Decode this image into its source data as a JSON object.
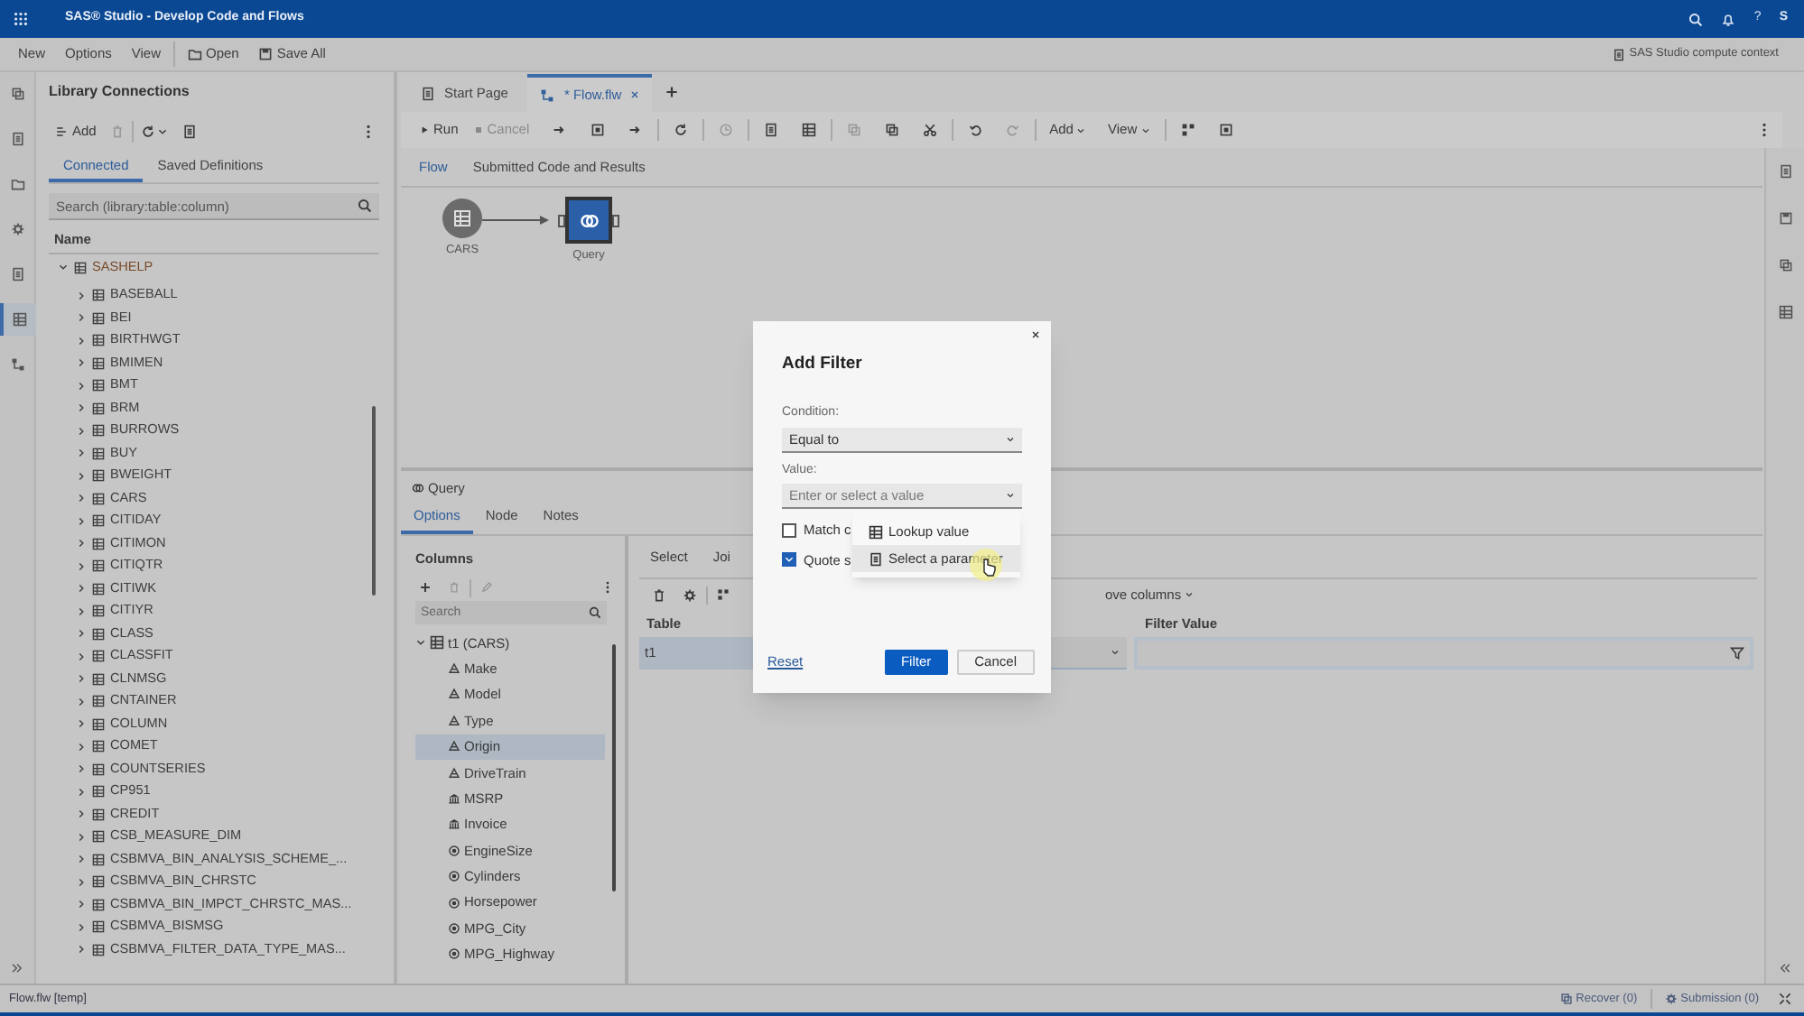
{
  "title_bar": {
    "title": "SAS® Studio - Develop Code and Flows",
    "help": "?",
    "user_initial": "S"
  },
  "menu_bar": {
    "items": [
      {
        "label": "New",
        "kind": "menu"
      },
      {
        "label": "Options",
        "kind": "menu"
      },
      {
        "label": "View",
        "kind": "menu"
      },
      {
        "label": "Open",
        "kind": "open"
      },
      {
        "label": "Save All",
        "kind": "save"
      }
    ],
    "context": "SAS Studio compute context"
  },
  "library_panel": {
    "title": "Library Connections",
    "add": "Add",
    "tabs": [
      {
        "label": "Connected",
        "selected": true
      },
      {
        "label": "Saved Definitions",
        "selected": false
      }
    ],
    "search": {
      "placeholder": "Search (library:table:column)"
    },
    "column_header": "Name",
    "tree": [
      {
        "label": "SASHELP",
        "expanded": true,
        "children": [
          {
            "label": "BASEBALL",
            "expanded": false
          },
          {
            "label": "BEI",
            "expanded": false
          },
          {
            "label": "BIRTHWGT",
            "expanded": false
          },
          {
            "label": "BMIMEN",
            "expanded": false
          },
          {
            "label": "BMT",
            "expanded": false
          },
          {
            "label": "BRM",
            "expanded": false
          },
          {
            "label": "BURROWS",
            "expanded": false
          },
          {
            "label": "BUY",
            "expanded": false
          },
          {
            "label": "BWEIGHT",
            "expanded": false
          },
          {
            "label": "CARS",
            "expanded": false
          },
          {
            "label": "CITIDAY",
            "expanded": false
          },
          {
            "label": "CITIMON",
            "expanded": false
          },
          {
            "label": "CITIQTR",
            "expanded": false
          },
          {
            "label": "CITIWK",
            "expanded": false
          },
          {
            "label": "CITIYR",
            "expanded": false
          },
          {
            "label": "CLASS",
            "expanded": false
          },
          {
            "label": "CLASSFIT",
            "expanded": false
          },
          {
            "label": "CLNMSG",
            "expanded": false
          },
          {
            "label": "CNTAINER",
            "expanded": false
          },
          {
            "label": "COLUMN",
            "expanded": false
          },
          {
            "label": "COMET",
            "expanded": false
          },
          {
            "label": "COUNTSERIES",
            "expanded": false
          },
          {
            "label": "CP951",
            "expanded": false
          },
          {
            "label": "CREDIT",
            "expanded": false
          },
          {
            "label": "CSB_MEASURE_DIM",
            "expanded": false
          },
          {
            "label": "CSBMVA_BIN_ANALYSIS_SCHEME_...",
            "expanded": false
          },
          {
            "label": "CSBMVA_BIN_CHRSTC",
            "expanded": false
          },
          {
            "label": "CSBMVA_BIN_IMPCT_CHRSTC_MAS...",
            "expanded": false
          },
          {
            "label": "CSBMVA_BISMSG",
            "expanded": false
          },
          {
            "label": "CSBMVA_FILTER_DATA_TYPE_MAS...",
            "expanded": false
          }
        ]
      }
    ]
  },
  "editor_tabs": [
    {
      "label": "Start Page",
      "kind": "page",
      "selected": false
    },
    {
      "label": "* Flow.flw",
      "kind": "flow",
      "selected": true
    }
  ],
  "toolbar": {
    "run": "Run",
    "cancel": "Cancel",
    "add": "Add",
    "view": "View"
  },
  "view_tabs": [
    {
      "label": "Flow",
      "selected": true
    },
    {
      "label": "Submitted Code and Results",
      "selected": false
    }
  ],
  "flow": {
    "nodes": [
      {
        "label": "CARS",
        "kind": "table",
        "selected": false
      },
      {
        "label": "Query",
        "kind": "query",
        "selected": true
      }
    ]
  },
  "query_panel": {
    "title": "Query",
    "tabs": [
      {
        "label": "Options",
        "selected": true
      },
      {
        "label": "Node",
        "selected": false
      },
      {
        "label": "Notes",
        "selected": false
      }
    ],
    "columns_pane": {
      "title": "Columns",
      "search": {
        "placeholder": "Search"
      },
      "tree": [
        {
          "label": "t1 (CARS)",
          "expanded": true,
          "children": [
            {
              "label": "Make",
              "kind": "char",
              "selected": false
            },
            {
              "label": "Model",
              "kind": "char",
              "selected": false
            },
            {
              "label": "Type",
              "kind": "char",
              "selected": false
            },
            {
              "label": "Origin",
              "kind": "char",
              "selected": true
            },
            {
              "label": "DriveTrain",
              "kind": "char",
              "selected": false
            },
            {
              "label": "MSRP",
              "kind": "currency",
              "selected": false
            },
            {
              "label": "Invoice",
              "kind": "currency",
              "selected": false
            },
            {
              "label": "EngineSize",
              "kind": "num",
              "selected": false
            },
            {
              "label": "Cylinders",
              "kind": "num",
              "selected": false
            },
            {
              "label": "Horsepower",
              "kind": "num",
              "selected": false
            },
            {
              "label": "MPG_City",
              "kind": "num",
              "selected": false
            },
            {
              "label": "MPG_Highway",
              "kind": "num",
              "selected": false
            }
          ]
        }
      ]
    },
    "option_tabs": [
      {
        "label": "Select"
      },
      {
        "label": "Joi"
      }
    ],
    "move_columns": "ove columns",
    "table": {
      "columns": [
        "Table",
        "Filter Value"
      ],
      "rows": [
        {
          "table": "t1"
        }
      ]
    }
  },
  "dialog": {
    "title": "Add Filter",
    "condition": {
      "label": "Condition:",
      "value": "Equal to"
    },
    "value": {
      "label": "Value:",
      "placeholder": "Enter or select a value"
    },
    "checkboxes": [
      {
        "label": "Match c",
        "checked": false
      },
      {
        "label": "Quote s",
        "checked": true
      }
    ],
    "menu": [
      {
        "label": "Lookup value",
        "selected": false
      },
      {
        "label": "Select a parameter",
        "selected": true
      }
    ],
    "reset": "Reset",
    "buttons": [
      {
        "label": "Filter",
        "kind": "primary"
      },
      {
        "label": "Cancel",
        "kind": "secondary"
      }
    ]
  },
  "status_bar": {
    "file": "Flow.flw [temp]",
    "recover": "Recover (0)",
    "submission": "Submission (0)"
  }
}
